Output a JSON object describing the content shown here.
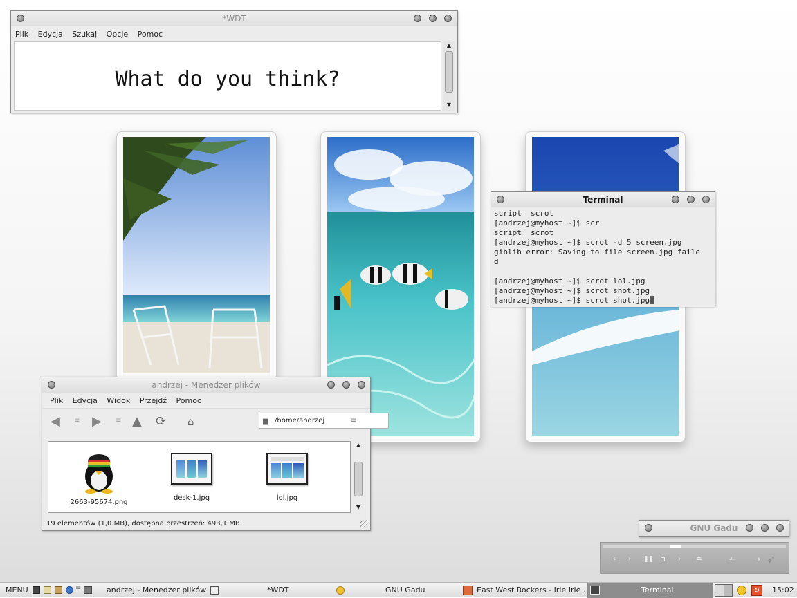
{
  "wdt": {
    "title": "*WDT",
    "menu": [
      "Plik",
      "Edycja",
      "Szukaj",
      "Opcje",
      "Pomoc"
    ],
    "text": "What do you think?"
  },
  "terminal": {
    "title": "Terminal",
    "lines": [
      "script  scrot",
      "[andrzej@myhost ~]$ scr",
      "script  scrot",
      "[andrzej@myhost ~]$ scrot -d 5 screen.jpg",
      "giblib error: Saving to file screen.jpg faile",
      "d",
      "",
      "[andrzej@myhost ~]$ scrot lol.jpg",
      "[andrzej@myhost ~]$ scrot shot.jpg",
      "[andrzej@myhost ~]$ scrot shot.jpg"
    ]
  },
  "filemanager": {
    "title": "andrzej - Menedżer plików",
    "menu": [
      "Plik",
      "Edycja",
      "Widok",
      "Przejdź",
      "Pomoc"
    ],
    "path": "/home/andrzej",
    "files": [
      {
        "name": "2663-95674.png"
      },
      {
        "name": "desk-1.jpg"
      },
      {
        "name": "lol.jpg"
      }
    ],
    "status": "19 elementów (1,0 MB), dostępna przestrzeń: 493,1 MB"
  },
  "gadu": {
    "title": "GNU Gadu"
  },
  "taskbar": {
    "menu_label": "MENU",
    "tasks": [
      {
        "label": "andrzej - Menedżer plików"
      },
      {
        "label": "*WDT"
      },
      {
        "label": "GNU Gadu"
      },
      {
        "label": "East West Rockers - Irie Irie ..."
      },
      {
        "label": "Terminal"
      }
    ],
    "clock": "15:02"
  },
  "colors": {
    "accent": "#8d8d8d",
    "desktop": "#f4f4f4"
  }
}
